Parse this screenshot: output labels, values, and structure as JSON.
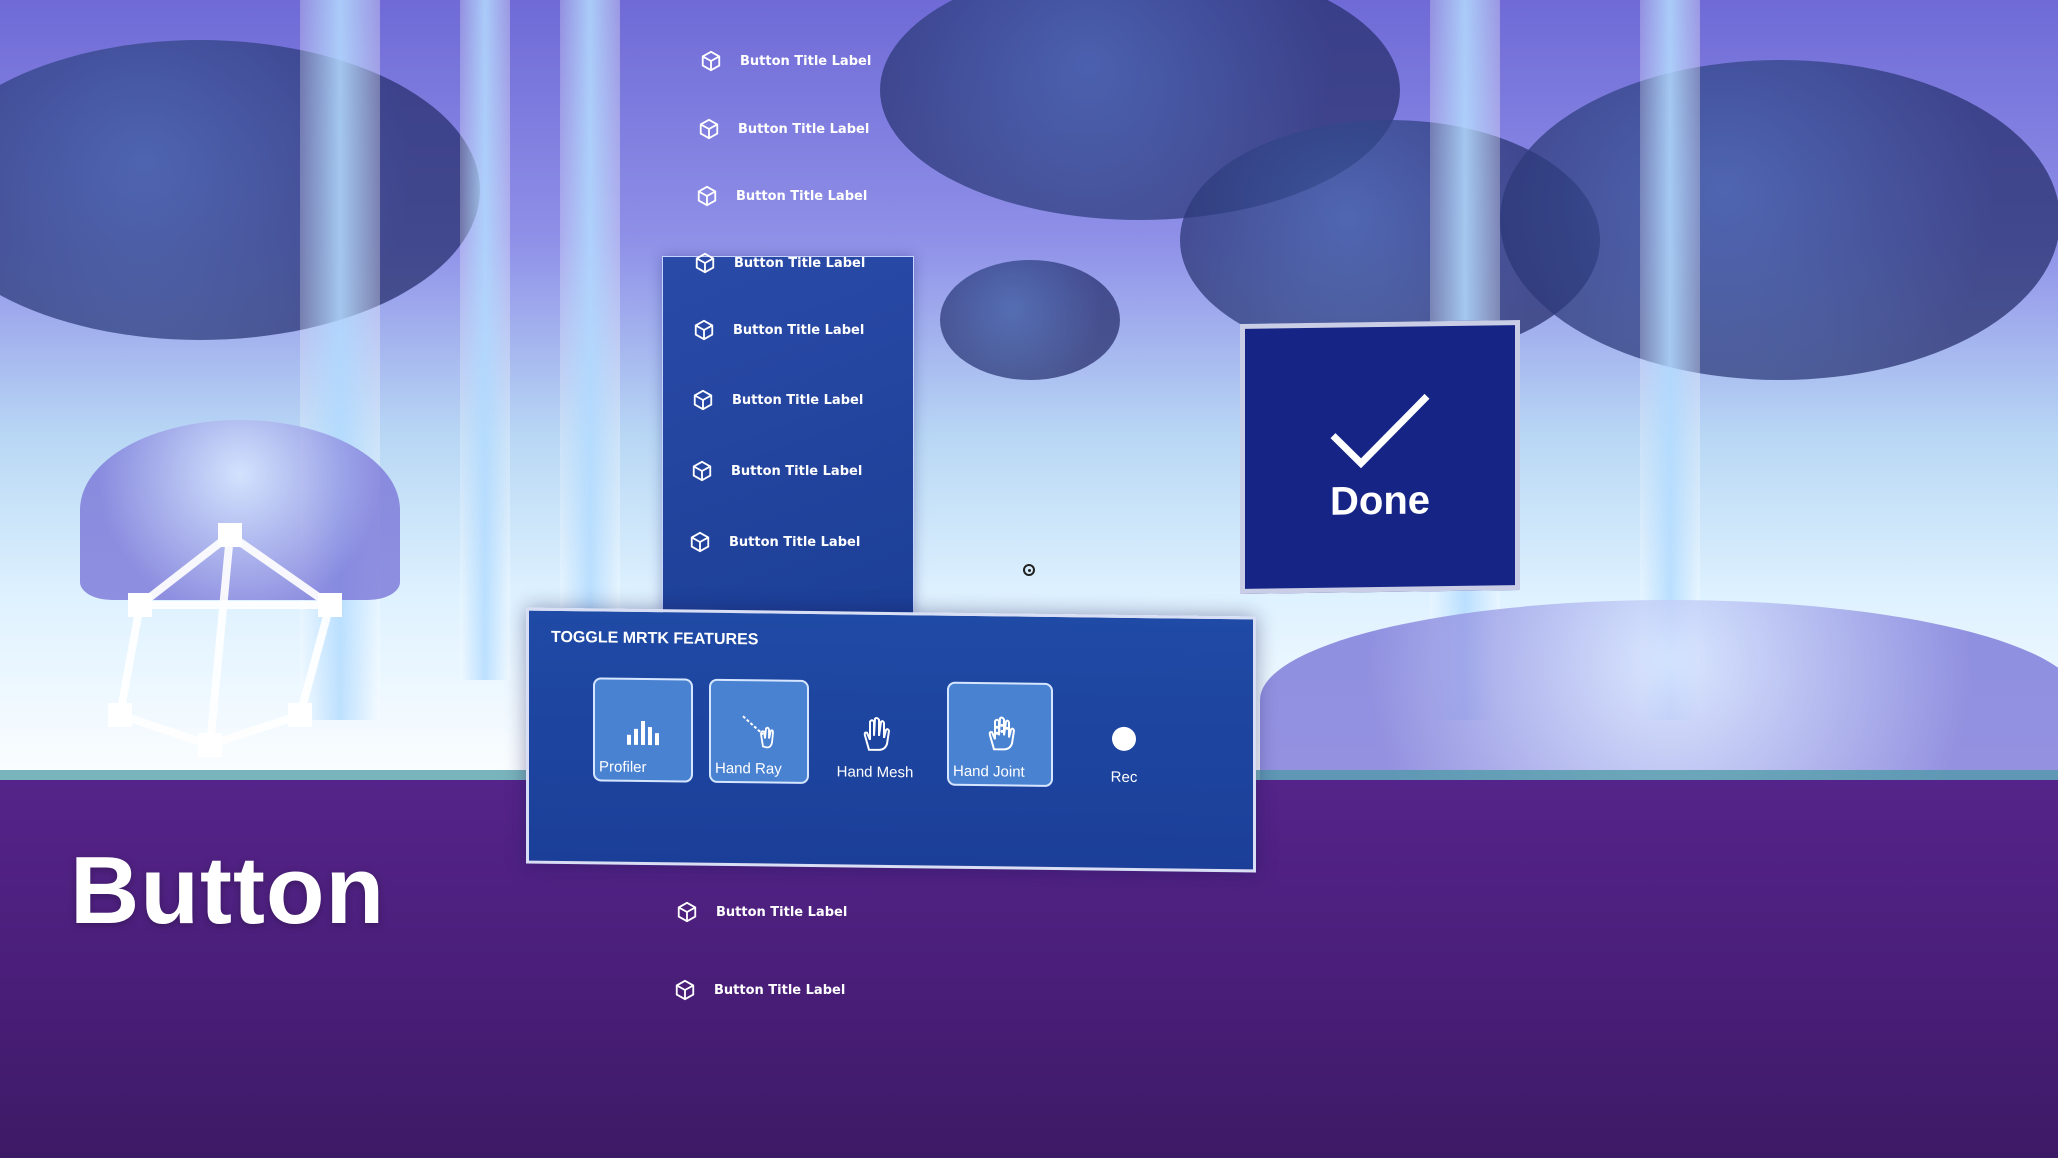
{
  "scene_label": "Button",
  "list_items": [
    "Button Title Label",
    "Button Title Label",
    "Button Title Label",
    "Button Title Label",
    "Button Title Label",
    "Button Title Label",
    "Button Title Label",
    "Button Title Label",
    "Button Title Label",
    "Button Title Label"
  ],
  "toolbar": {
    "title": "TOGGLE MRTK FEATURES",
    "buttons": [
      {
        "label": "Profiler",
        "icon": "profiler-icon",
        "toggled": true
      },
      {
        "label": "Hand Ray",
        "icon": "hand-ray-icon",
        "toggled": true
      },
      {
        "label": "Hand Mesh",
        "icon": "hand-icon",
        "toggled": false
      },
      {
        "label": "Hand Joint",
        "icon": "hand-joint-icon",
        "toggled": true
      },
      {
        "label": "Rec",
        "icon": "record-icon",
        "toggled": false
      }
    ]
  },
  "done_button": {
    "label": "Done",
    "icon": "checkmark-icon"
  },
  "colors": {
    "panel_blue": "#1f4aa5",
    "toggle_on": "#4a82d2",
    "done_blue": "#162486",
    "floor_purple": "#4a1e7a"
  }
}
